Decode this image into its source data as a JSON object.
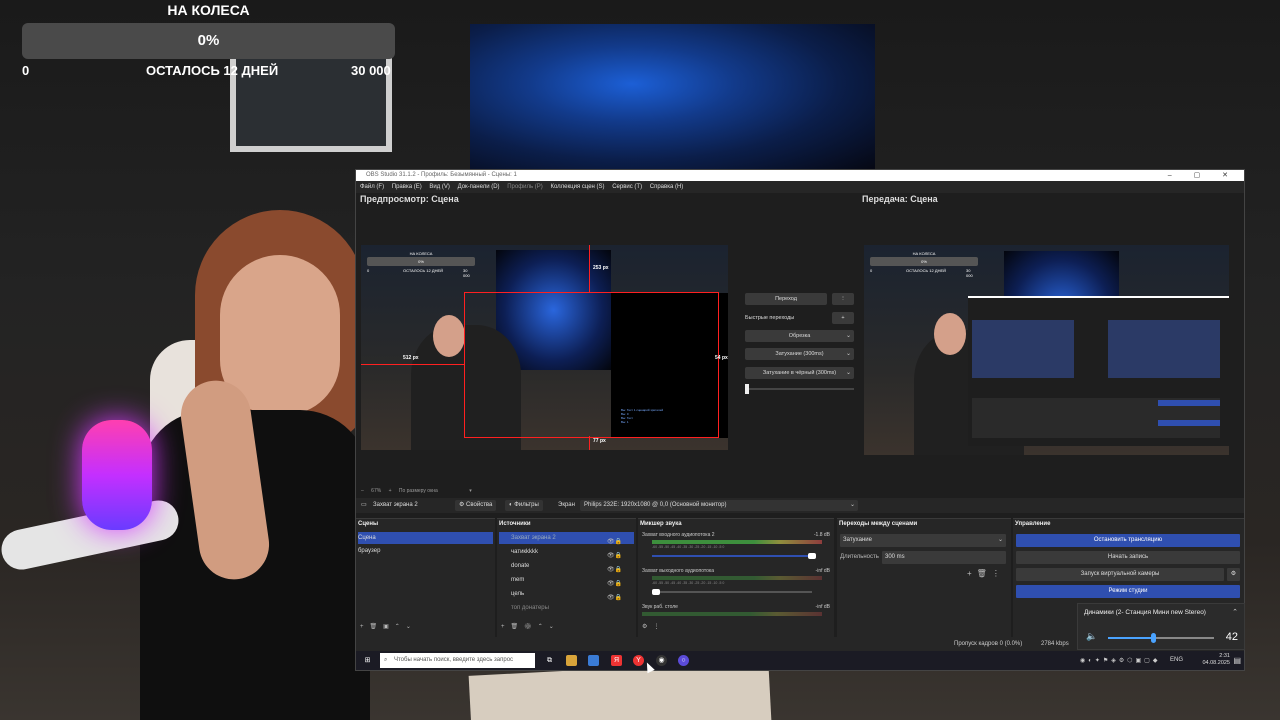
{
  "goal": {
    "title": "НА КОЛЕСА",
    "progress_text": "0%",
    "progress": 0,
    "min": "0",
    "remaining": "ОСТАЛОСЬ 12 ДНЕЙ",
    "max": "30 000"
  },
  "obs": {
    "title": "OBS Studio 31.1.2 - Профиль: Безымянный - Сцены: 1",
    "menu": [
      "Файл (F)",
      "Правка (E)",
      "Вид (V)",
      "Док-панели (D)",
      "Профиль (P)",
      "Коллекция сцен (S)",
      "Сервис (T)",
      "Справка (H)"
    ],
    "preview_label": "Предпросмотр: Сцена",
    "program_label": "Передача: Сцена",
    "mini_goal": {
      "title": "НА КОЛЕСА",
      "pct": "0%",
      "min": "0",
      "left": "ОСТАЛОСЬ 12 ДНЕЙ",
      "max": "30 000"
    },
    "guides": {
      "top": "253 px",
      "left": "512 px",
      "right": "54 px",
      "bottom": "77 px"
    },
    "chat": [
      "Вы: Тест 1 сценарий зрителей",
      "Вы: 0",
      "Вы: Тест",
      "Вы: 1 "
    ],
    "transition_btn": "Переход",
    "quick_transitions": "Быстрые переходы",
    "quick_items": [
      "Обрезка",
      "Затухание (300ms)",
      "Затухание в чёрный (300ms)"
    ],
    "zoom": "67%",
    "fit": "По размеру окна",
    "source_name": "Захват экрана 2",
    "properties": "Свойства",
    "filters": "Фильтры",
    "screen_label": "Экран",
    "screen_value": "Philips 232E: 1920x1080 @ 0,0 (Основной монитор)",
    "scenes_title": "Сцены",
    "scenes": [
      "Сцена",
      "браузер"
    ],
    "sources_title": "Источники",
    "sources": [
      "Захват экрана 2",
      "чатикkkkk",
      "donate",
      "mem",
      "цель",
      "топ донатеры"
    ],
    "mixer_title": "Микшер звука",
    "mixer": [
      {
        "name": "Захват входного аудиопотока 2",
        "db": "-1.8 dB"
      },
      {
        "name": "Захват выходного аудиопотока",
        "db": "-inf dB"
      },
      {
        "name": "Звук раб. столе",
        "db": "-inf dB"
      }
    ],
    "meter_ticks": "-60 -55 -50 -45 -40 -35 -30 -25 -20 -15 -10 -5 0",
    "transitions_title": "Переходы между сценами",
    "transition_type": "Затухание",
    "duration_label": "Длительность",
    "duration": "300 ms",
    "controls_title": "Управление",
    "controls": {
      "stop_stream": "Остановить трансляцию",
      "record": "Начать запись",
      "virtual_cam": "Запуск виртуальной камеры",
      "studio": "Режим студии"
    },
    "status": {
      "dropped": "Пропуск кадров 0 (0.0%)",
      "bitrate": "2784 kbps"
    }
  },
  "taskbar": {
    "search_placeholder": "Чтобы начать поиск, введите здесь запрос",
    "lang": "ENG",
    "time": "2:31",
    "date": "04.08.2025"
  },
  "volume": {
    "device": "Динамики (2- Станция Мини new Stereo)",
    "level_text": "42",
    "level": 42
  },
  "colors": {
    "accent": "#2f4fb0",
    "guide": "#ff2020",
    "goal_bar": "#4a4a4a"
  }
}
